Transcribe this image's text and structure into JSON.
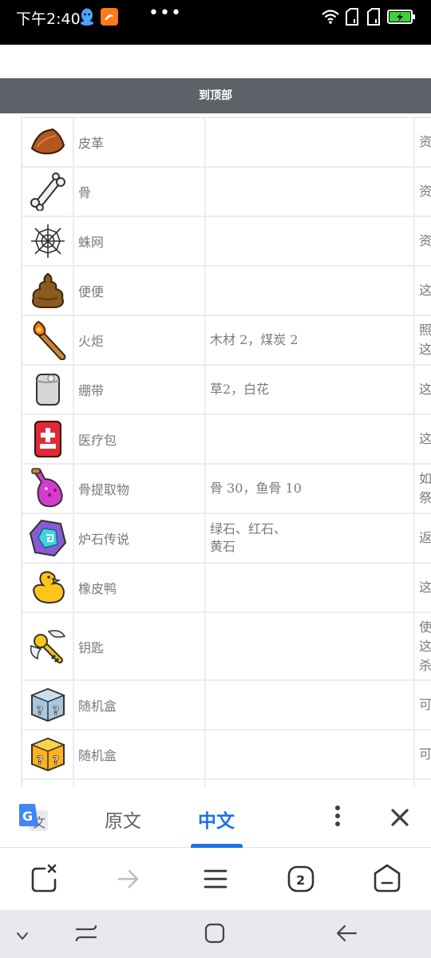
{
  "status_bar": {
    "time": "下午2:40"
  },
  "to_top": {
    "label": "到顶部"
  },
  "table": {
    "rows": [
      {
        "icon": "leather-icon",
        "name": "皮革",
        "recipe": "",
        "desc": "资"
      },
      {
        "icon": "bone-icon",
        "name": "骨",
        "recipe": "",
        "desc": "资"
      },
      {
        "icon": "spider-web-icon",
        "name": "蛛网",
        "recipe": "",
        "desc": "资"
      },
      {
        "icon": "poop-icon",
        "name": "便便",
        "recipe": "",
        "desc": "这"
      },
      {
        "icon": "torch-icon",
        "name": "火炬",
        "recipe": "木材 2，煤炭 2",
        "desc": "照\n这"
      },
      {
        "icon": "bandage-icon",
        "name": "绷带",
        "recipe": "草2，白花",
        "desc": "这"
      },
      {
        "icon": "medkit-icon",
        "name": "医疗包",
        "recipe": "",
        "desc": "这"
      },
      {
        "icon": "potion-icon",
        "name": "骨提取物",
        "recipe": "骨 30，鱼骨 10",
        "desc": "如\n祭"
      },
      {
        "icon": "hearthstone-icon",
        "name": "炉石传说",
        "recipe": "绿石、红石、\n黄石",
        "desc": "返"
      },
      {
        "icon": "rubber-duck-icon",
        "name": "橡皮鸭",
        "recipe": "",
        "desc": "这"
      },
      {
        "icon": "key-icon",
        "name": "钥匙",
        "recipe": "",
        "desc": "使\n这\n杀"
      },
      {
        "icon": "mystery-box-blue-icon",
        "name": "随机盒",
        "recipe": "",
        "desc": "可"
      },
      {
        "icon": "mystery-box-gold-icon",
        "name": "随机盒",
        "recipe": "",
        "desc": "可"
      }
    ]
  },
  "translate_bar": {
    "original_label": "原文",
    "chinese_label": "中文",
    "logo_char": "文",
    "logo_g": "G"
  },
  "browser_bar": {
    "tab_count": "2"
  }
}
